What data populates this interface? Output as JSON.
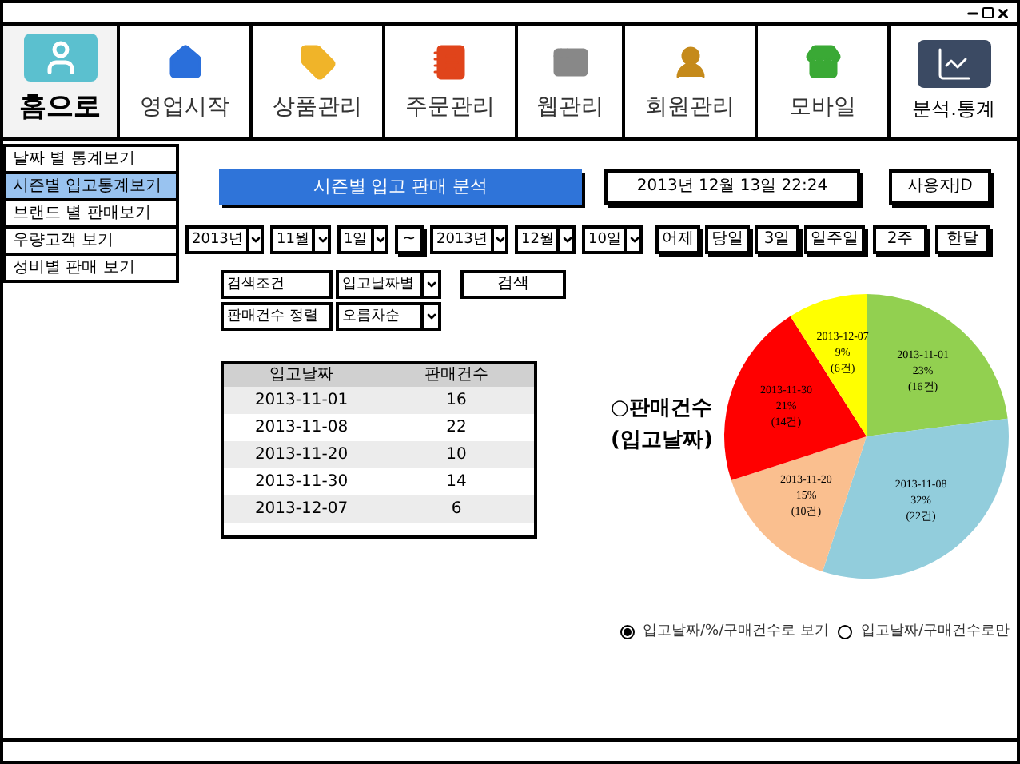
{
  "nav": [
    {
      "label": "홈으로",
      "kind": "home",
      "selected": true
    },
    {
      "label": "영업시작",
      "kind": "house",
      "selected": false
    },
    {
      "label": "상품관리",
      "kind": "tag",
      "selected": false
    },
    {
      "label": "주문관리",
      "kind": "notebook",
      "selected": false
    },
    {
      "label": "웹관리",
      "kind": "window",
      "selected": false
    },
    {
      "label": "회원관리",
      "kind": "person",
      "selected": false
    },
    {
      "label": "모바일",
      "kind": "store",
      "selected": false
    },
    {
      "label": "분석.통계",
      "kind": "chart",
      "selected": false
    }
  ],
  "sidebar": {
    "items": [
      {
        "label": "날짜 별 통계보기",
        "selected": false
      },
      {
        "label": "시즌별 입고통계보기",
        "selected": true
      },
      {
        "label": "브랜드 별 판매보기",
        "selected": false
      },
      {
        "label": "우량고객 보기",
        "selected": false
      },
      {
        "label": "성비별 판매 보기",
        "selected": false
      }
    ]
  },
  "page_title": "시즌별 입고 판매 분석",
  "datetime": "2013년 12월 13일 22:24",
  "user": "사용자JD",
  "date_range": {
    "from": [
      "2013년",
      "11월",
      "1일"
    ],
    "separator": "~",
    "to": [
      "2013년",
      "12월",
      "10일"
    ]
  },
  "quick_buttons": [
    "어제",
    "당일",
    "3일",
    "일주일",
    "2주",
    "한달"
  ],
  "filters": [
    {
      "label": "검색조건",
      "value": "입고날짜별"
    },
    {
      "label": "판매건수 정렬",
      "value": "오름차순"
    }
  ],
  "search_button": "검색",
  "table": {
    "columns": [
      "입고날짜",
      "판매건수"
    ],
    "rows": [
      [
        "2013-11-01",
        "16"
      ],
      [
        "2013-11-08",
        "22"
      ],
      [
        "2013-11-20",
        "10"
      ],
      [
        "2013-11-30",
        "14"
      ],
      [
        "2013-12-07",
        "6"
      ]
    ]
  },
  "chart_title": [
    "○판매건수",
    "(입고날짜)"
  ],
  "chart_data": {
    "type": "pie",
    "categories": [
      "2013-11-01",
      "2013-11-08",
      "2013-11-20",
      "2013-11-30",
      "2013-12-07"
    ],
    "values": [
      23,
      32,
      15,
      21,
      9
    ],
    "colors": [
      "#92d050",
      "#92cddc",
      "#fabf8f",
      "#ff0000",
      "#ffff00"
    ],
    "value_labels": [
      "23%",
      "32%",
      "15%",
      "21%",
      "9%"
    ],
    "annotations": [
      "(16건)",
      "(22건)",
      "(10건)",
      "(14건)",
      "(6건)"
    ]
  },
  "view_options": [
    {
      "label": "입고날짜/%/구매건수로 보기",
      "selected": true
    },
    {
      "label": "입고날짜/구매건수로만",
      "selected": false
    }
  ]
}
